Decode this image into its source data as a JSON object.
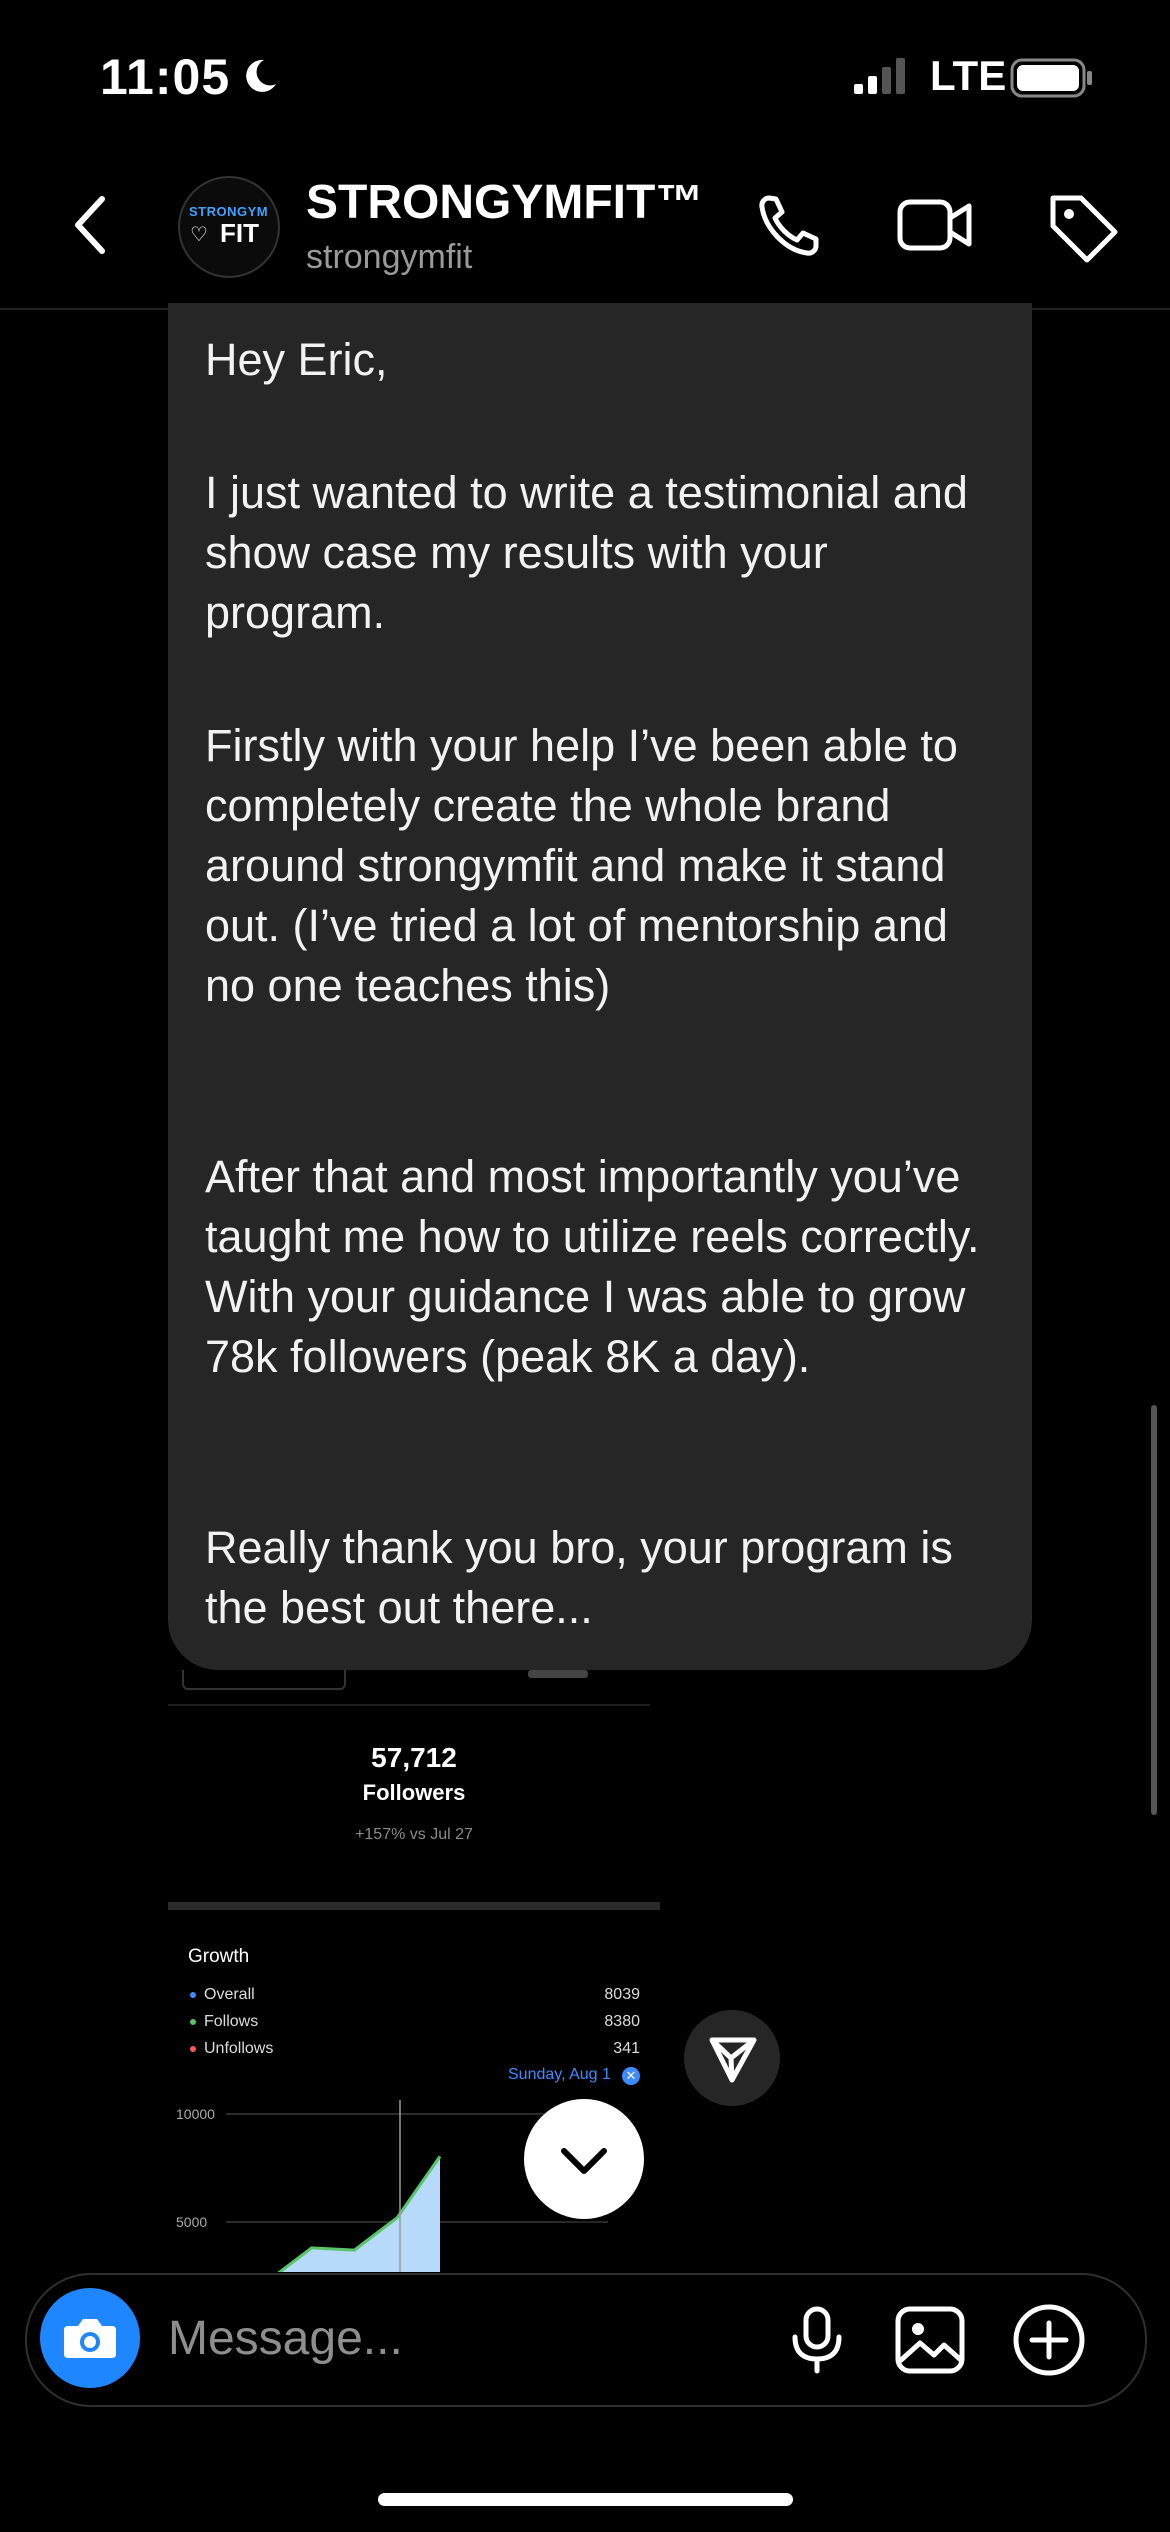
{
  "status_bar": {
    "time": "11:05",
    "network": "LTE"
  },
  "header": {
    "name": "STRONGYMFIT™",
    "handle": "strongymfit",
    "avatar_top": "STRONGYM",
    "avatar_bottom": "FIT"
  },
  "message": {
    "paragraphs": [
      "Hey Eric,",
      "I just wanted to write a testimonial and show case my results with your program.",
      "Firstly with your help I’ve been able to completely create the whole brand around strongymfit and make it stand out. (I’ve tried a lot of mentorship and no one teaches this)",
      "After that and most importantly you’ve taught me how to utilize reels correctly. With your guidance I was able to grow 78k followers (peak 8K a day).",
      "Really thank you bro, your program is the best out there..."
    ]
  },
  "attachment": {
    "followers_count": "57,712",
    "followers_label": "Followers",
    "followers_delta": "+157% vs Jul 27",
    "growth_title": "Growth",
    "legend": [
      {
        "label": "Overall",
        "value": "8039",
        "color": "#3d8bff"
      },
      {
        "label": "Follows",
        "value": "8380",
        "color": "#5ac46b"
      },
      {
        "label": "Unfollows",
        "value": "341",
        "color": "#ff5a5a"
      }
    ],
    "selected_date": "Sunday, Aug 1",
    "chart_data": {
      "type": "area",
      "yticks": [
        "10000",
        "5000"
      ],
      "ylim": [
        0,
        10000
      ],
      "series": [
        {
          "name": "Overall",
          "values": [
            700,
            2300,
            3800,
            3700,
            5200,
            8039
          ]
        }
      ]
    }
  },
  "composer": {
    "placeholder": "Message..."
  },
  "colors": {
    "accent": "#1e86ff",
    "bubble": "#262626",
    "chart_fill": "#b7dafb"
  }
}
